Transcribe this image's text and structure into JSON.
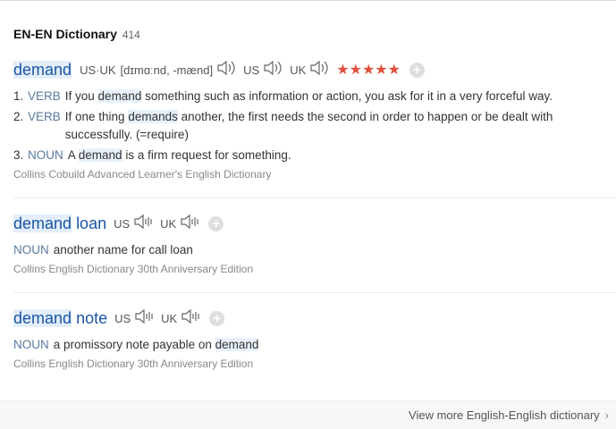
{
  "section": {
    "title": "EN-EN Dictionary",
    "count": "414"
  },
  "entries": [
    {
      "headword": "demand",
      "pron_label": "US·UK",
      "pron_text": "[dɪmɑːnd, -mænd]",
      "us_label": "US",
      "uk_label": "UK",
      "stars": "★★★★★",
      "add": "+",
      "defs": [
        {
          "num": "1.",
          "pos": "VERB",
          "pre": "If you ",
          "hl": "demand",
          "post": " something such as information or action, you ask for it in a very forceful way."
        },
        {
          "num": "2.",
          "pos": "VERB",
          "pre": "If one thing ",
          "hl": "demands",
          "post": " another, the first needs the second in order to happen or be dealt with successfully. (=require)"
        },
        {
          "num": "3.",
          "pos": "NOUN",
          "pre": "A ",
          "hl": "demand",
          "post": " is a firm request for something."
        }
      ],
      "source": "Collins Cobuild Advanced Learner's English Dictionary"
    },
    {
      "headword": "demand",
      "rest": "loan",
      "us_label": "US",
      "uk_label": "UK",
      "add": "+",
      "pos": "NOUN",
      "definition": "another name for call loan",
      "source": "Collins English Dictionary 30th Anniversary Edition"
    },
    {
      "headword": "demand",
      "rest": "note",
      "us_label": "US",
      "uk_label": "UK",
      "add": "+",
      "pos": "NOUN",
      "definition_pre": "a promissory note payable on ",
      "definition_hl": "demand",
      "source": "Collins English Dictionary 30th Anniversary Edition"
    }
  ],
  "footer": {
    "more": "View more English-English dictionary",
    "chevron": "›"
  },
  "colors": {
    "accent": "#1a55a5",
    "stars": "#e0503b",
    "highlight": "#e3eefa"
  }
}
